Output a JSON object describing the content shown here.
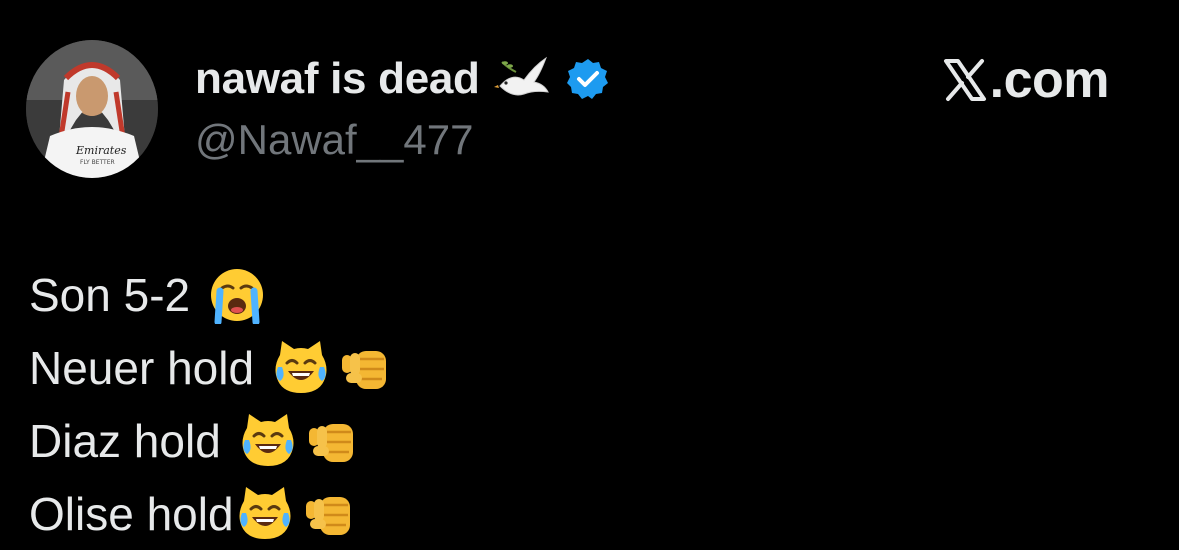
{
  "author": {
    "display_name": "nawaf is dead",
    "handle": "@Nawaf__477",
    "avatar_jersey_text": "Emirates",
    "avatar_jersey_subtext": "FLY BETTER",
    "badges": [
      "dove-icon",
      "verified-icon"
    ]
  },
  "brand": {
    "label": ".com",
    "logo": "x-logo-icon"
  },
  "tweet": {
    "lines": [
      {
        "text": "Son 5-2",
        "emojis": [
          "loudly-crying-face-icon"
        ]
      },
      {
        "text": "Neuer hold",
        "emojis": [
          "cat-tears-of-joy-icon",
          "pointing-fist-icon"
        ]
      },
      {
        "text": "Diaz hold",
        "emojis": [
          "cat-tears-of-joy-icon",
          "pointing-fist-icon"
        ]
      },
      {
        "text": "Olise hold",
        "emojis": [
          "cat-tears-of-joy-icon",
          "pointing-fist-icon"
        ]
      }
    ]
  },
  "colors": {
    "background": "#000000",
    "primary_text": "#e7e9ea",
    "secondary_text": "#71767b",
    "verified_blue": "#1d9bf0"
  }
}
